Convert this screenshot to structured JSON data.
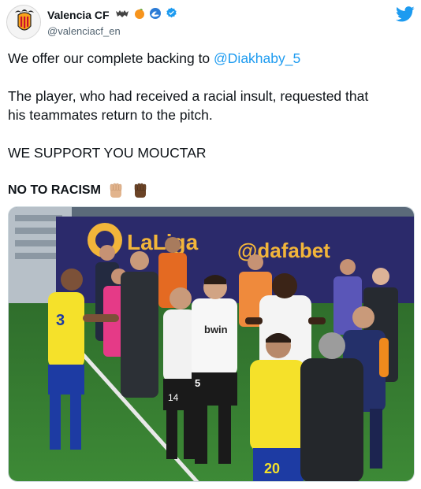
{
  "header": {
    "display_name": "Valencia CF",
    "handle": "@valenciacf_en"
  },
  "icons": {
    "avatar": "valencia-crest",
    "verified": "verified-badge-icon",
    "twitter": "twitter-bird-icon",
    "emoji_bat": "bat-emoji",
    "emoji_orange": "orange-emoji",
    "emoji_wave": "wave-emoji"
  },
  "tweet": {
    "line1_prefix": "We offer our complete backing to ",
    "line1_mention": "@Diakhaby_5",
    "line2a": "The player, who had received a racial insult, requested that",
    "line2b": "his teammates return to the pitch.",
    "line3": "WE SUPPORT YOU MOUCTAR",
    "line4": "NO TO RACISM"
  },
  "photo": {
    "sponsor_logo_a": "LaLiga",
    "sponsor_logo_b": "@dafabet",
    "kit_sponsor": "bwin",
    "number_left_player": "3",
    "number_center_player": "5",
    "number_player_14": "14",
    "number_player_20": "20"
  },
  "colors": {
    "accent_blue": "#1d9bf0",
    "text": "#0f1419",
    "muted": "#536471"
  }
}
